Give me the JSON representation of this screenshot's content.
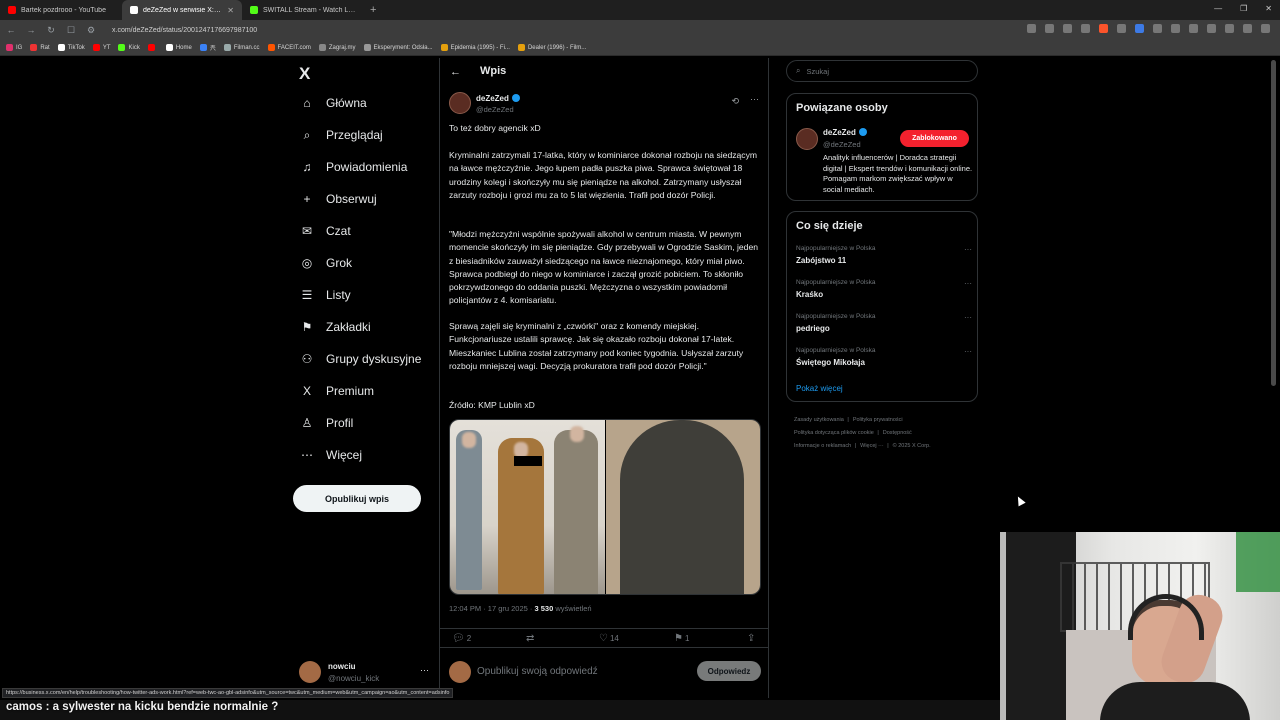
{
  "browser": {
    "tabs": [
      {
        "title": "Bartek pozdrooo - YouTube",
        "color": "#ff0000"
      },
      {
        "title": "deZeZed w serwisie X: „To też d",
        "color": "#ffffff",
        "active": true
      },
      {
        "title": "SWITALL Stream - Watch Live on Kick",
        "color": "#53fc18"
      }
    ],
    "new_tab": "+",
    "url": "x.com/deZeZed/status/2001247176697987100",
    "bookmarks": [
      {
        "label": "IG",
        "color": "#e1306c"
      },
      {
        "label": "Rat",
        "color": "#e33"
      },
      {
        "label": "TikTok",
        "color": "#fff"
      },
      {
        "label": "YT",
        "color": "#f00"
      },
      {
        "label": "Kick",
        "color": "#53fc18"
      },
      {
        "label": "",
        "color": "#f00"
      },
      {
        "label": "Home",
        "color": "#fff"
      },
      {
        "label": "兲",
        "color": "#3b82f6"
      },
      {
        "label": "Filman.cc",
        "color": "#9aa"
      },
      {
        "label": "FACEIT.com",
        "color": "#f50"
      },
      {
        "label": "Zagraj.my",
        "color": "#888"
      },
      {
        "label": "Eksperyment: Odsła...",
        "color": "#999"
      },
      {
        "label": "Epidemia (1995) - Fi...",
        "color": "#e5a00d"
      },
      {
        "label": "Dealer (1996) - Film...",
        "color": "#e5a00d"
      }
    ]
  },
  "nav": {
    "logo": "X",
    "items": [
      {
        "label": "Główna",
        "icon": "⌂"
      },
      {
        "label": "Przeglądaj",
        "icon": "⌕"
      },
      {
        "label": "Powiadomienia",
        "icon": "♫"
      },
      {
        "label": "Obserwuj",
        "icon": "+"
      },
      {
        "label": "Czat",
        "icon": "✉"
      },
      {
        "label": "Grok",
        "icon": "◎"
      },
      {
        "label": "Listy",
        "icon": "☰"
      },
      {
        "label": "Zakładki",
        "icon": "⚑"
      },
      {
        "label": "Grupy dyskusyjne",
        "icon": "⚇"
      },
      {
        "label": "Premium",
        "icon": "X"
      },
      {
        "label": "Profil",
        "icon": "♙"
      },
      {
        "label": "Więcej",
        "icon": "⋯"
      }
    ],
    "post_button": "Opublikuj wpis",
    "account": {
      "name": "nowciu",
      "handle": "@nowciu_kick",
      "more": "···"
    }
  },
  "main": {
    "back": "←",
    "title": "Wpis",
    "author": {
      "name": "deZeZed",
      "handle": "@deZeZed"
    },
    "text": {
      "intro": "To też dobry agencik xD",
      "p1": "Kryminalni zatrzymali 17-latka, który w kominiarce dokonał rozboju na siedzącym na ławce mężczyźnie. Jego łupem padła puszka piwa. Sprawca świętował 18 urodziny kolegi i skończyły mu się pieniądze na alkohol. Zatrzymany usłyszał zarzuty rozboju i grozi mu za to 5 lat więzienia. Trafił pod dozór Policji.",
      "p2": "\"Młodzi mężczyźni wspólnie spożywali alkohol w centrum miasta. W pewnym momencie skończyły im się pieniądze. Gdy przebywali w Ogrodzie Saskim, jeden z biesiadników zauważył siedzącego na ławce nieznajomego, który miał piwo. Sprawca podbiegł do niego w kominiarce i zaczął grozić pobiciem. To skłoniło pokrzywdzonego do oddania puszki. Mężczyzna o wszystkim powiadomił policjantów z 4. komisariatu.",
      "p3": "Sprawą zajęli się kryminalni z „czwórki\" oraz z komendy miejskiej. Funkcjonariusze ustalili sprawcę. Jak się okazało rozboju dokonał 17-latek. Mieszkaniec Lublina został zatrzymany pod koniec tygodnia. Usłyszał zarzuty rozboju mniejszej wagi. Decyzją prokuratora trafił pod dozór Policji.\"",
      "source": "Źródło: KMP Lublin xD"
    },
    "time": "12:04 PM · 17 gru 2025 · ",
    "views": "3 530",
    "views_label": " wyświetleń",
    "actions": {
      "replies": "2",
      "reposts": "",
      "likes": "14",
      "bookmarks": "1"
    },
    "reply_placeholder": "Opublikuj swoją odpowiedź",
    "reply_button": "Odpowiedz"
  },
  "right": {
    "search_placeholder": "Szukaj",
    "related": {
      "title": "Powiązane osoby",
      "name": "deZeZed",
      "handle": "@deZeZed",
      "button": "Zablokowano",
      "bio": "Analityk influencerów | Doradca strategii digital | Ekspert trendów i komunikacji online. Pomagam markom zwiększać wpływ w social mediach."
    },
    "trends": {
      "title": "Co się dzieje",
      "items": [
        {
          "category": "Najpopularniejsze w Polska",
          "name": "Zabójstwo 11"
        },
        {
          "category": "Najpopularniejsze w Polska",
          "name": "Kraśko"
        },
        {
          "category": "Najpopularniejsze w Polska",
          "name": "pedriego"
        },
        {
          "category": "Najpopularniejsze w Polska",
          "name": "Świętego Mikołaja"
        }
      ],
      "show_more": "Pokaż więcej"
    },
    "footer": [
      "Zasady użytkowania",
      "Polityka prywatności",
      "Polityka dotycząca plików cookie",
      "Dostępność",
      "Informacje o reklamach",
      "Więcej ···",
      "© 2025 X Corp."
    ]
  },
  "overlay": {
    "status_url": "https://business.x.com/en/help/troubleshooting/how-twitter-ads-work.html?ref=web-twc-ao-gbl-adsinfo&utm_source=twc&utm_medium=web&utm_campaign=ao&utm_content=adsinfo",
    "chat": "camos : a sylwester na kicku bendzie normalnie ?"
  }
}
